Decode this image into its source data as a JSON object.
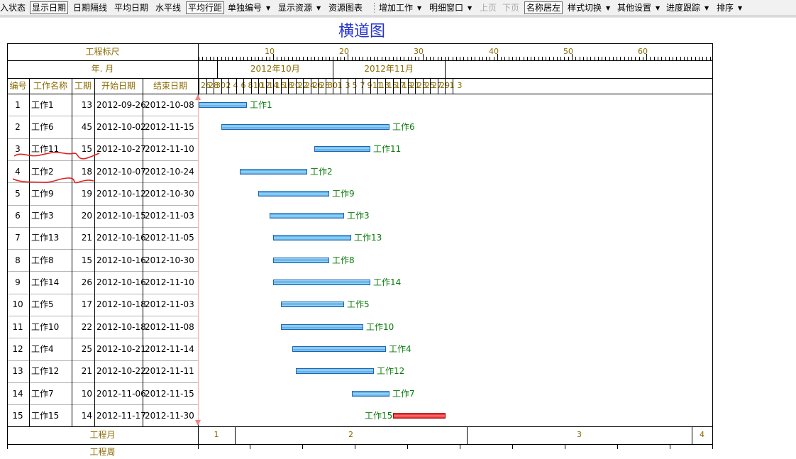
{
  "toolbar": {
    "items": [
      {
        "label": "入状态",
        "type": "button"
      },
      {
        "label": "显示日期",
        "type": "pressed"
      },
      {
        "label": "日期隔线",
        "type": "button"
      },
      {
        "label": "平均日期",
        "type": "button"
      },
      {
        "label": "水平线",
        "type": "button"
      },
      {
        "label": "平均行距",
        "type": "pressed"
      },
      {
        "label": "单独编号",
        "type": "dropdown"
      },
      {
        "label": "显示资源",
        "type": "dropdown"
      },
      {
        "label": "资源图表",
        "type": "button"
      },
      {
        "label": "增加工作",
        "type": "dropdown"
      },
      {
        "label": "明细窗口",
        "type": "dropdown"
      },
      {
        "label": "上页",
        "type": "disabled"
      },
      {
        "label": "下页",
        "type": "disabled"
      },
      {
        "label": "名称居左",
        "type": "pressed"
      },
      {
        "label": "样式切换",
        "type": "dropdown"
      },
      {
        "label": "其他设置",
        "type": "dropdown"
      },
      {
        "label": "进度跟踪",
        "type": "dropdown"
      },
      {
        "label": "排序",
        "type": "dropdown"
      }
    ],
    "dropdown_glyph": "▼"
  },
  "title": "横道图",
  "header": {
    "ruler_label": "工程标尺",
    "month_label": "年. 月",
    "col_no": "编号",
    "col_name": "工作名称",
    "col_days": "工期",
    "col_start": "开始日期",
    "col_end": "结束日期",
    "ruler_ticks": [
      "10",
      "20",
      "30",
      "40",
      "50",
      "60"
    ],
    "months": [
      "2012年10月",
      "2012年11月"
    ],
    "days": [
      "26",
      "28",
      "30",
      "2",
      "4",
      "6",
      "8",
      "10",
      "12",
      "14",
      "16",
      "18",
      "20",
      "22",
      "24",
      "26",
      "28",
      "30",
      "1",
      "3",
      "5",
      "7",
      "9",
      "11",
      "13",
      "15",
      "17",
      "19",
      "21",
      "23",
      "25",
      "27",
      "29",
      "1",
      "3"
    ]
  },
  "tasks": [
    {
      "no": "1",
      "name": "工作1",
      "days": "13",
      "start": "2012-09-26",
      "end": "2012-10-08",
      "label": "工作1",
      "critical": false
    },
    {
      "no": "2",
      "name": "工作6",
      "days": "45",
      "start": "2012-10-02",
      "end": "2012-11-15",
      "label": "工作6",
      "critical": false
    },
    {
      "no": "3",
      "name": "工作11",
      "days": "15",
      "start": "2012-10-27",
      "end": "2012-11-10",
      "label": "工作11",
      "critical": false
    },
    {
      "no": "4",
      "name": "工作2",
      "days": "18",
      "start": "2012-10-07",
      "end": "2012-10-24",
      "label": "工作2",
      "critical": false
    },
    {
      "no": "5",
      "name": "工作9",
      "days": "19",
      "start": "2012-10-12",
      "end": "2012-10-30",
      "label": "工作9",
      "critical": false
    },
    {
      "no": "6",
      "name": "工作3",
      "days": "20",
      "start": "2012-10-15",
      "end": "2012-11-03",
      "label": "工作3",
      "critical": false
    },
    {
      "no": "7",
      "name": "工作13",
      "days": "21",
      "start": "2012-10-16",
      "end": "2012-11-05",
      "label": "工作13",
      "critical": false
    },
    {
      "no": "8",
      "name": "工作8",
      "days": "15",
      "start": "2012-10-16",
      "end": "2012-10-30",
      "label": "工作8",
      "critical": false
    },
    {
      "no": "9",
      "name": "工作14",
      "days": "26",
      "start": "2012-10-16",
      "end": "2012-11-10",
      "label": "工作14",
      "critical": false
    },
    {
      "no": "10",
      "name": "工作5",
      "days": "17",
      "start": "2012-10-18",
      "end": "2012-11-03",
      "label": "工作5",
      "critical": false
    },
    {
      "no": "11",
      "name": "工作10",
      "days": "22",
      "start": "2012-10-18",
      "end": "2012-11-08",
      "label": "工作10",
      "critical": false
    },
    {
      "no": "12",
      "name": "工作4",
      "days": "25",
      "start": "2012-10-21",
      "end": "2012-11-14",
      "label": "工作4",
      "critical": false
    },
    {
      "no": "13",
      "name": "工作12",
      "days": "21",
      "start": "2012-10-22",
      "end": "2012-11-11",
      "label": "工作12",
      "critical": false
    },
    {
      "no": "14",
      "name": "工作7",
      "days": "10",
      "start": "2012-11-06",
      "end": "2012-11-15",
      "label": "工作7",
      "critical": false
    },
    {
      "no": "15",
      "name": "工作15",
      "days": "14",
      "start": "2012-11-17",
      "end": "2012-11-30",
      "label": "工作15",
      "critical": true
    }
  ],
  "footer": {
    "label": "工程月",
    "months": [
      "1",
      "2",
      "3",
      "4"
    ],
    "next_label": "工程周"
  },
  "colors": {
    "title": "#2533d4",
    "header_text": "#8a6a00",
    "bar_label": "#0b7a0b",
    "bar": "#5eb0e6",
    "critical_bar": "#e03030",
    "annotation": "#e02020"
  }
}
